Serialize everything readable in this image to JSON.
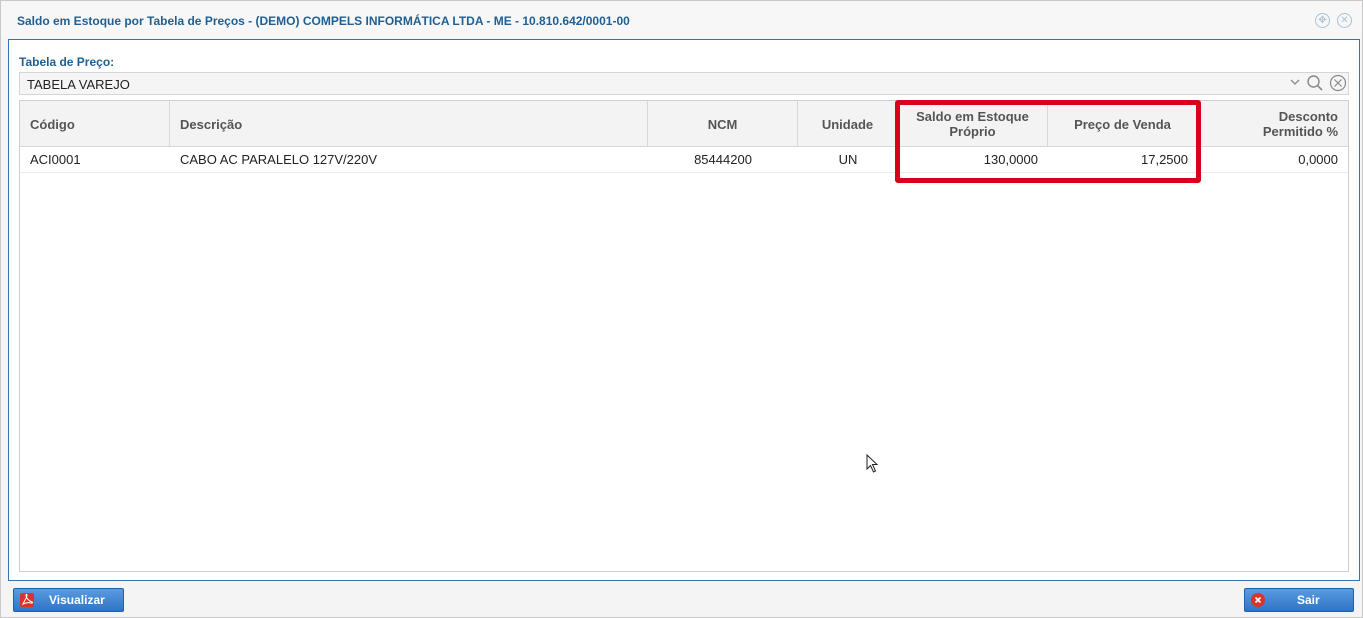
{
  "window": {
    "title": "Saldo em Estoque por Tabela de Preços - (DEMO) COMPELS INFORMÁTICA LTDA - ME - 10.810.642/0001-00",
    "icons": [
      "move-icon",
      "close-circle-icon"
    ]
  },
  "filter": {
    "label": "Tabela de Preço:",
    "value": "TABELA VAREJO",
    "icons": [
      "chevron-down-icon",
      "search-icon",
      "clear-icon"
    ]
  },
  "table": {
    "columns": [
      "Código",
      "Descrição",
      "NCM",
      "Unidade",
      "Saldo em Estoque Próprio",
      "Preço de Venda",
      "Desconto Permitido %"
    ],
    "rows": [
      [
        "ACI0001",
        "CABO AC PARALELO 127V/220V",
        "85444200",
        "UN",
        "130,0000",
        "17,2500",
        "0,0000"
      ]
    ]
  },
  "buttons": {
    "visualizar": "Visualizar",
    "sair": "Sair"
  },
  "colors": {
    "accent": "#1f5f93",
    "highlight": "#d9001b",
    "button": "#2f74c7"
  }
}
